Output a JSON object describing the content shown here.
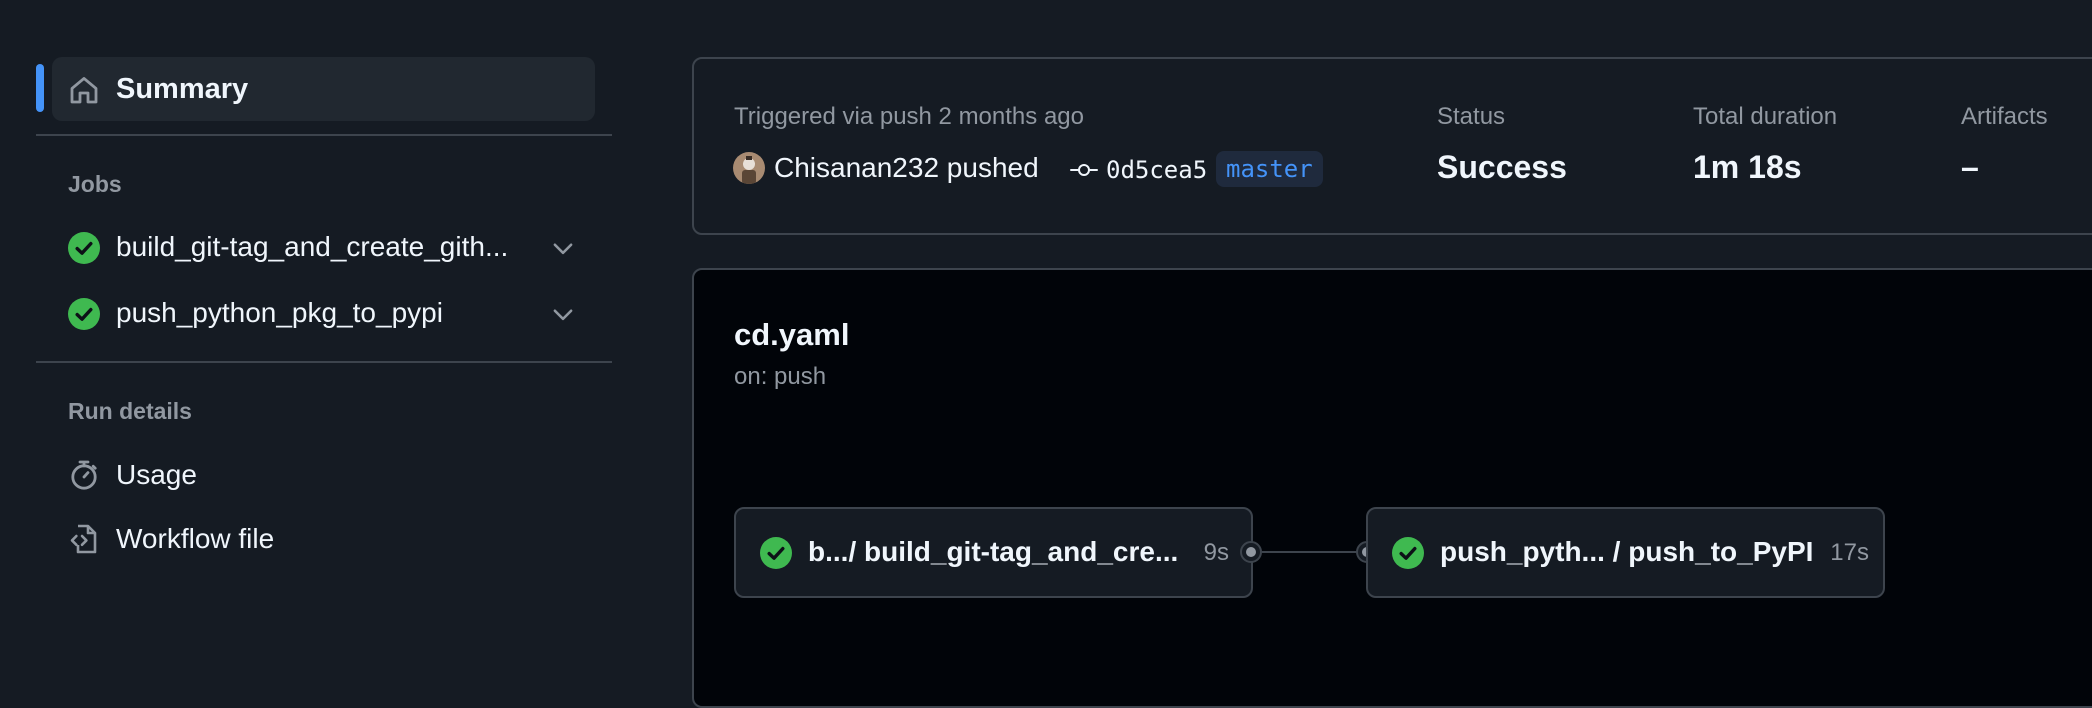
{
  "sidebar": {
    "summary_label": "Summary",
    "jobs_heading": "Jobs",
    "jobs": [
      {
        "label": "build_git-tag_and_create_gith...",
        "status": "success"
      },
      {
        "label": "push_python_pkg_to_pypi",
        "status": "success"
      }
    ],
    "run_details_heading": "Run details",
    "details": [
      {
        "label": "Usage",
        "icon": "stopwatch-icon"
      },
      {
        "label": "Workflow file",
        "icon": "file-code-icon"
      }
    ]
  },
  "run": {
    "trigger": "Triggered via push 2 months ago",
    "actor": "Chisanan232 pushed",
    "commit": "0d5cea5",
    "branch": "master",
    "status_label": "Status",
    "status_value": "Success",
    "duration_label": "Total duration",
    "duration_value": "1m 18s",
    "artifacts_label": "Artifacts",
    "artifacts_value": "–"
  },
  "workflow": {
    "name": "cd.yaml",
    "trigger": "on: push",
    "nodes": [
      {
        "label": "b.../ build_git-tag_and_cre...",
        "duration": "9s"
      },
      {
        "label": "push_pyth...  / push_to_PyPI",
        "duration": "17s"
      }
    ]
  },
  "colors": {
    "accent": "#4493f8",
    "success": "#3fb950",
    "background": "#151b23",
    "canvas": "#010409",
    "border": "#3d444d",
    "muted": "#9198a1"
  }
}
